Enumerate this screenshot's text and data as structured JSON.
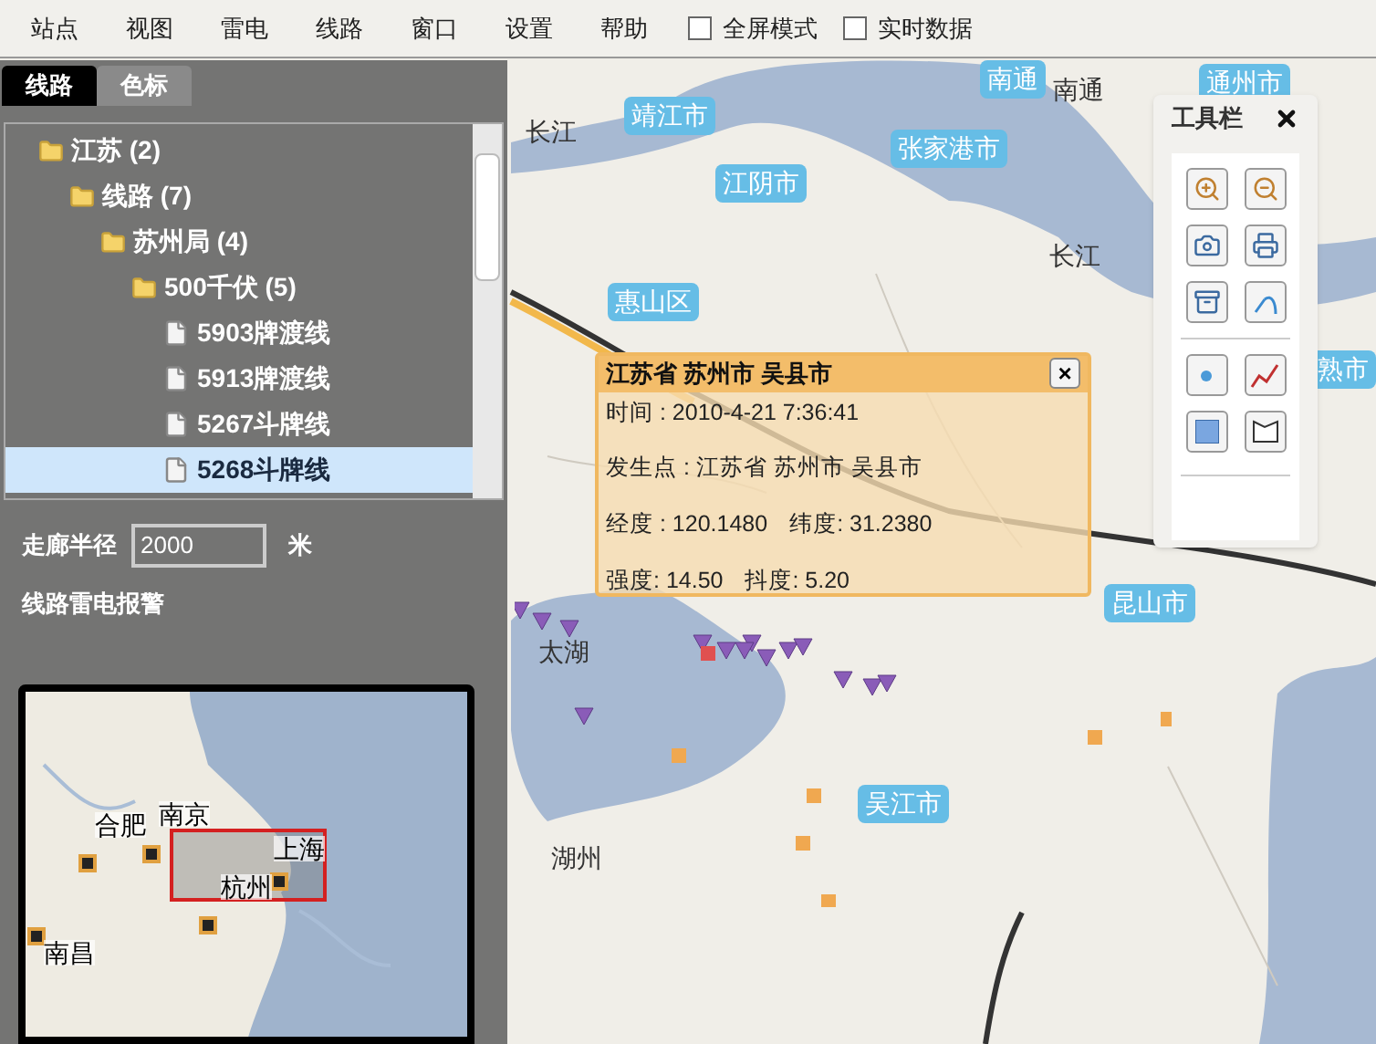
{
  "menu": [
    "站点",
    "视图",
    "雷电",
    "线路",
    "窗口",
    "设置",
    "帮助"
  ],
  "options": [
    {
      "label": "全屏模式",
      "checked": false
    },
    {
      "label": "实时数据",
      "checked": false
    }
  ],
  "panel": {
    "tabs": [
      {
        "label": "线路",
        "selected": true
      },
      {
        "label": "色标",
        "selected": false
      }
    ],
    "tree": [
      {
        "label": "江苏 (2)",
        "kind": "folder",
        "selected": false,
        "children": [
          {
            "label": "线路 (7)",
            "kind": "folder",
            "selected": false,
            "children": [
              {
                "label": "苏州局 (4)",
                "kind": "folder",
                "selected": false,
                "children": [
                  {
                    "label": "500千伏 (5)",
                    "kind": "folder",
                    "selected": false,
                    "children": [
                      {
                        "label": "5903牌渡线",
                        "kind": "file",
                        "selected": false
                      },
                      {
                        "label": "5913牌渡线",
                        "kind": "file",
                        "selected": false
                      },
                      {
                        "label": "5267斗牌线",
                        "kind": "file",
                        "selected": false
                      },
                      {
                        "label": "5268斗牌线",
                        "kind": "file",
                        "selected": true
                      }
                    ]
                  }
                ]
              }
            ]
          }
        ]
      }
    ],
    "corridor": {
      "label": "走廊半径",
      "value": "2000",
      "unit": "米"
    },
    "alarm": "线路雷电报警",
    "overview": {
      "labels": [
        "合肥",
        "南京",
        "上海",
        "杭州",
        "南昌"
      ]
    }
  },
  "map_labels": [
    {
      "text": "南通",
      "kind": "city"
    },
    {
      "text": "南通",
      "kind": "plain"
    },
    {
      "text": "通州市",
      "kind": "city"
    },
    {
      "text": "长江",
      "kind": "plain"
    },
    {
      "text": "靖江市",
      "kind": "city"
    },
    {
      "text": "张家港市",
      "kind": "city"
    },
    {
      "text": "江阴市",
      "kind": "city"
    },
    {
      "text": "长江",
      "kind": "plain"
    },
    {
      "text": "惠山区",
      "kind": "city"
    },
    {
      "text": "熟市",
      "kind": "city"
    },
    {
      "text": "昆山市",
      "kind": "city"
    },
    {
      "text": "太湖",
      "kind": "plain"
    },
    {
      "text": "吴江市",
      "kind": "city"
    },
    {
      "text": "湖州",
      "kind": "plain"
    }
  ],
  "popup": {
    "title": "江苏省 苏州市 吴县市",
    "close": "×",
    "rows": [
      [
        "时间 : 2010-4-21 7:36:41"
      ],
      [
        "发生点 : 江苏省 苏州市 吴县市"
      ],
      [
        "经度 : 120.1480",
        "纬度: 31.2380"
      ],
      [
        "强度: 14.50",
        "抖度: 5.20"
      ]
    ]
  },
  "toolbar": {
    "title": "工具栏"
  }
}
